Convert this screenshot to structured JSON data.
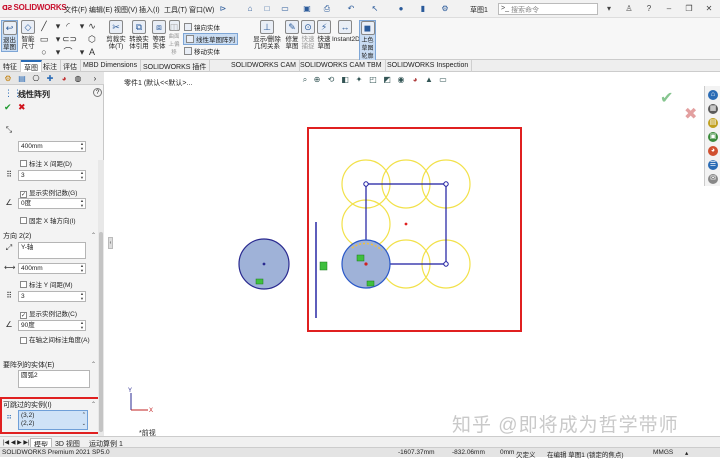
{
  "app": {
    "logo": "SOLIDWORKS",
    "doc_title": "草图1",
    "search_placeholder": "搜索命令"
  },
  "menu": [
    "文件(F)",
    "编辑(E)",
    "视图(V)",
    "插入(I)",
    "工具(T)",
    "窗口(W)"
  ],
  "ribbon": {
    "exit_sketch": "退出\n草图",
    "smart_dim": "智能\n尺寸",
    "trim": "剪裁实\n体(T)",
    "convert": "转换实\n体引用",
    "offset": "等距\n实体",
    "surface_offset": "曲面\n上偏\n移",
    "mirror": "镜向实体",
    "linear_pattern": "线性草图阵列",
    "move": "移动实体",
    "show_hide": "显示/删除\n几何关系",
    "repair": "修复\n草图",
    "quick_snap": "快速\n捕捉",
    "rapid_sketch": "快速\n草图",
    "instant2d": "Instant2D",
    "shaded": "上色\n草图\n轮廓"
  },
  "tabs": [
    "特征",
    "草图",
    "标注",
    "评估",
    "MBD Dimensions",
    "SOLIDWORKS 插件",
    "SOLIDWORKS CAM",
    "SOLIDWORKS CAM TBM",
    "SOLIDWORKS Inspection"
  ],
  "active_tab": "草图",
  "panel": {
    "title": "线性阵列",
    "help": "?",
    "dir1": {
      "spacing": "400mm",
      "dim_x_spacing": "标注 X 间距(D)",
      "count": "3",
      "show_count": "显示实例记数(G)",
      "angle": "0度",
      "fix_x": "固定 X 轴方向(I)"
    },
    "dir2": {
      "header": "方向 2(2)",
      "axis": "Y-轴",
      "spacing": "400mm",
      "dim_y_spacing": "标注 Y 间距(M)",
      "count": "3",
      "show_count": "显示实例记数(C)",
      "angle": "90度",
      "dim_between_axes": "在轴之间标注角度(A)"
    },
    "entities": {
      "header": "要阵列的实体(E)",
      "items": [
        "圆弧2"
      ]
    },
    "skip": {
      "header": "可跳过的实例(I)",
      "items": [
        "(3,2)",
        "(2,2)"
      ]
    }
  },
  "canvas": {
    "breadcrumb": "零件1 (默认<<默认>...",
    "view_label": "*前视",
    "watermark": "知乎 @即将成为哲学带师",
    "confirm_ok": "✔",
    "confirm_cancel": "✖"
  },
  "bottom_tabs": [
    "模型",
    "3D 视图",
    "运动算例 1"
  ],
  "status": {
    "edition": "SOLIDWORKS Premium 2021 SP5.0",
    "x": "-1607.37mm",
    "y": "-832.06mm",
    "z": "0mm",
    "defined": "欠定义",
    "editing": "在编辑 草图1 (锁定的焦点)",
    "units": "MMGS"
  }
}
